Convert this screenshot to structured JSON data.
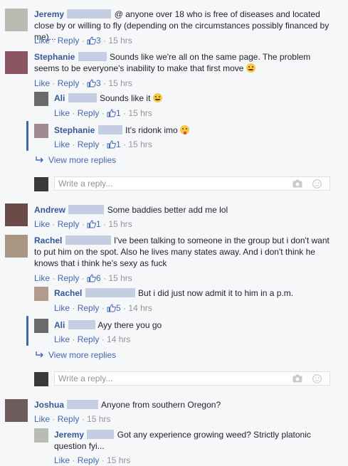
{
  "colors": {
    "link": "#4267b2",
    "name": "#365899",
    "meta": "#90949c",
    "bg": "#f6f7f9"
  },
  "icons": {
    "like": "thumbs-up-icon",
    "reply": "reply-arrow-icon",
    "camera": "camera-icon",
    "emoji": "emoji-icon"
  },
  "labels": {
    "like": "Like",
    "reply": "Reply",
    "view_more": "View more replies",
    "write_placeholder": "Write a reply..."
  },
  "comments": [
    {
      "name": "Jeremy",
      "text": "@ anyone over 18 who is free of diseases and located close by or willing to fly (depending on the circumstances possibly financed by me)...",
      "likes": "3",
      "time": "15 hrs"
    },
    {
      "name": "Stephanie",
      "text": "Sounds like we're all on the same page. The problem seems to be everyone's inability to make that first move",
      "likes": "3",
      "time": "15 hrs",
      "replies": [
        {
          "name": "Ali",
          "text": "Sounds like it",
          "likes": "1",
          "time": "15 hrs"
        },
        {
          "name": "Stephanie",
          "text": "It's ridonk imo",
          "likes": "1",
          "time": "15 hrs"
        }
      ]
    },
    {
      "name": "Andrew",
      "text": "Some baddies better add me lol",
      "likes": "1",
      "time": "15 hrs"
    },
    {
      "name": "Rachel",
      "text": "I've been talking to someone in the group but i don't want to put him on the spot. Also he lives many states away. And i don't think he knows that i think he's sexy as fuck",
      "likes": "6",
      "time": "15 hrs",
      "replies": [
        {
          "name": "Rachel",
          "text": "But i did just now admit it to him in a p.m.",
          "likes": "5",
          "time": "14 hrs"
        },
        {
          "name": "Ali",
          "text": "Ayy there you go",
          "likes": "",
          "time": "14 hrs"
        }
      ]
    },
    {
      "name": "Joshua",
      "text": "Anyone from southern Oregon?",
      "likes": "",
      "time": "15 hrs",
      "replies": [
        {
          "name": "Jeremy",
          "text": "Got any experience growing weed? Strictly platonic question fyi...",
          "likes": "",
          "time": "15 hrs"
        }
      ]
    }
  ]
}
